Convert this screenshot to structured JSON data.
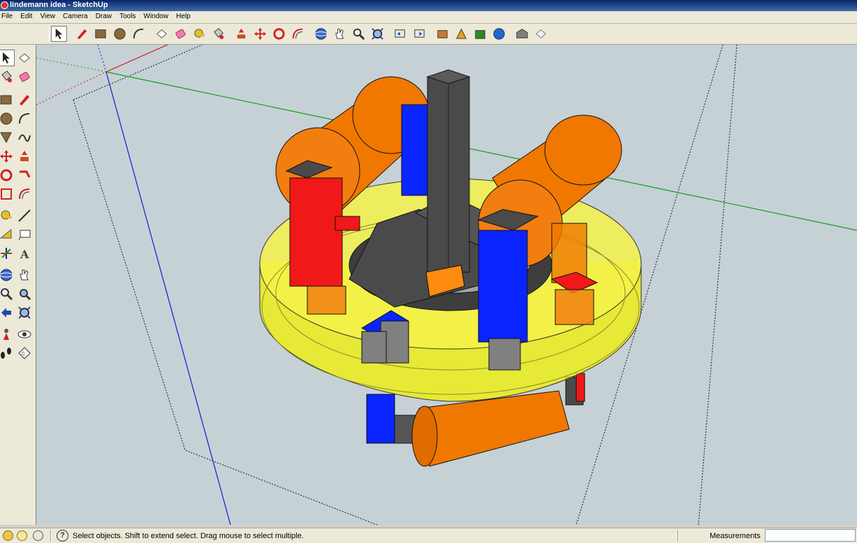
{
  "window": {
    "title": "lindemann idea - SketchUp"
  },
  "menu": [
    "File",
    "Edit",
    "View",
    "Camera",
    "Draw",
    "Tools",
    "Window",
    "Help"
  ],
  "toolbar_icons": [
    "select-icon",
    "pencil-icon",
    "rectangle-icon",
    "circle-icon",
    "arc-icon",
    "make-component-icon",
    "eraser-icon",
    "tape-measure-icon",
    "paint-bucket-icon",
    "push-pull-icon",
    "move-icon",
    "rotate-icon",
    "offset-icon",
    "orbit-icon",
    "pan-icon",
    "zoom-icon",
    "zoom-extents-icon",
    "previous-view-icon",
    "next-view-icon",
    "get-models-icon",
    "share-model-icon",
    "share-component-icon",
    "get-photo-texture-icon",
    "3d-warehouse-icon",
    "extension-icon"
  ],
  "left_tools": [
    [
      "select-icon",
      "make-component-icon"
    ],
    [
      "paint-bucket-icon",
      "eraser-icon"
    ],
    [
      "rectangle-icon",
      "line-icon"
    ],
    [
      "circle-icon",
      "arc-icon"
    ],
    [
      "polygon-icon",
      "freehand-icon"
    ],
    [
      "move-icon",
      "push-pull-icon"
    ],
    [
      "rotate-icon",
      "follow-me-icon"
    ],
    [
      "scale-icon",
      "offset-icon"
    ],
    [
      "tape-measure-icon",
      "dimension-icon"
    ],
    [
      "protractor-icon",
      "text-icon"
    ],
    [
      "axes-icon",
      "3d-text-icon"
    ],
    [
      "orbit-icon",
      "pan-icon"
    ],
    [
      "zoom-icon",
      "zoom-window-icon"
    ],
    [
      "previous-icon",
      "zoom-extents-icon"
    ],
    [
      "position-camera-icon",
      "look-around-icon"
    ],
    [
      "walk-icon",
      "section-plane-icon"
    ]
  ],
  "status": {
    "message": "Select objects. Shift to extend select. Drag mouse to select multiple.",
    "measurements_label": "Measurements",
    "measurements_value": ""
  },
  "colors": {
    "viewport_bg": "#c6d1d6",
    "orange": "#f07800",
    "blue": "#0a24ff",
    "red": "#f01818",
    "dark_gray": "#4a4a4a",
    "yellow_translucent": "#f0f000"
  }
}
